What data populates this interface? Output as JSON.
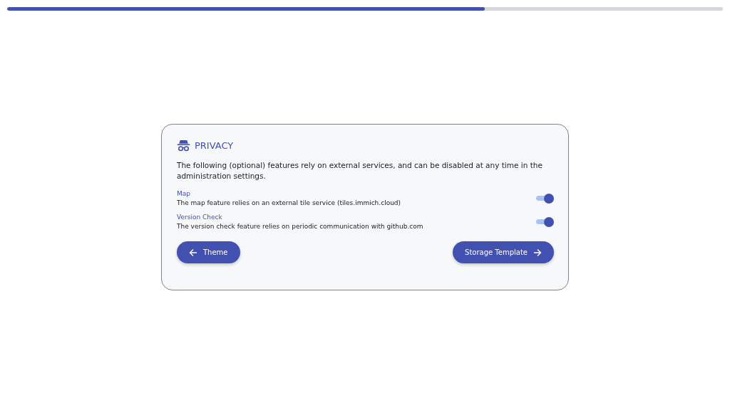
{
  "progress": {
    "level": 0.667
  },
  "card": {
    "title": "PRIVACY",
    "description": "The following (optional) features rely on external services, and can be disabled at any time in the administration settings.",
    "settings": [
      {
        "label": "Map",
        "description": "The map feature relies on an external tile service (tiles.immich.cloud)",
        "on": true
      },
      {
        "label": "Version Check",
        "description": "The version check feature relies on periodic communication with github.com",
        "on": true
      }
    ],
    "back_button": "Theme",
    "next_button": "Storage Template"
  }
}
